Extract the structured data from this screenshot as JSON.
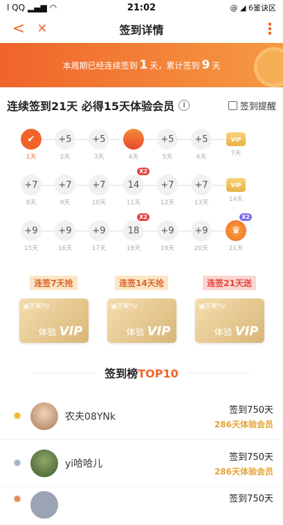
{
  "status": {
    "carrier": "l QQ",
    "time": "21:02",
    "right": "@ ◢ 6鉴诀区"
  },
  "nav": {
    "back": "<",
    "close": "✕",
    "title": "签到详情",
    "more": "⋮"
  },
  "banner": {
    "pre": "本周期已经连续签到",
    "days": "1",
    "mid": "天，累计签到",
    "total": "9",
    "post": "天"
  },
  "headline": {
    "text": "连续签到21天 必得15天体验会员",
    "info": "i",
    "remind_label": "签到提醒"
  },
  "calendar": {
    "row1": [
      "✔",
      "+5",
      "+5",
      "",
      "+5",
      "+5",
      "VIP"
    ],
    "row1_labels": [
      "1天",
      "2天",
      "3天",
      "4天",
      "5天",
      "6天",
      "7天"
    ],
    "row2": [
      "+7",
      "+7",
      "+7",
      "14",
      "+7",
      "+7",
      "VIP"
    ],
    "row2_labels": [
      "8天",
      "9天",
      "10天",
      "11天",
      "12天",
      "13天",
      "14天"
    ],
    "row3": [
      "+9",
      "+9",
      "+9",
      "18",
      "+9",
      "+9",
      "♛"
    ],
    "row3_labels": [
      "15天",
      "16天",
      "17天",
      "18天",
      "19天",
      "20天",
      "21天"
    ],
    "badge": "X2"
  },
  "rewards": [
    {
      "tag": "连签7天抢",
      "brand": "▣芒果TV",
      "label": "体验",
      "vip": "VIP"
    },
    {
      "tag": "连签14天抢",
      "brand": "▣芒果TV",
      "label": "体验",
      "vip": "VIP"
    },
    {
      "tag": "连签21天送",
      "brand": "▣芒果TV",
      "label": "体验",
      "vip": "VIP"
    }
  ],
  "rank": {
    "title": "签到榜",
    "title_accent": "TOP10",
    "items": [
      {
        "name": "农夫08YNk",
        "days": "签到750天",
        "member": "286天体验会员"
      },
      {
        "name": "yi哈哈儿",
        "days": "签到750天",
        "member": "286天体验会员"
      },
      {
        "name": "",
        "days": "签到750天",
        "member": ""
      }
    ]
  },
  "colors": {
    "accent": "#f0642a",
    "gold": "#e6a233"
  }
}
